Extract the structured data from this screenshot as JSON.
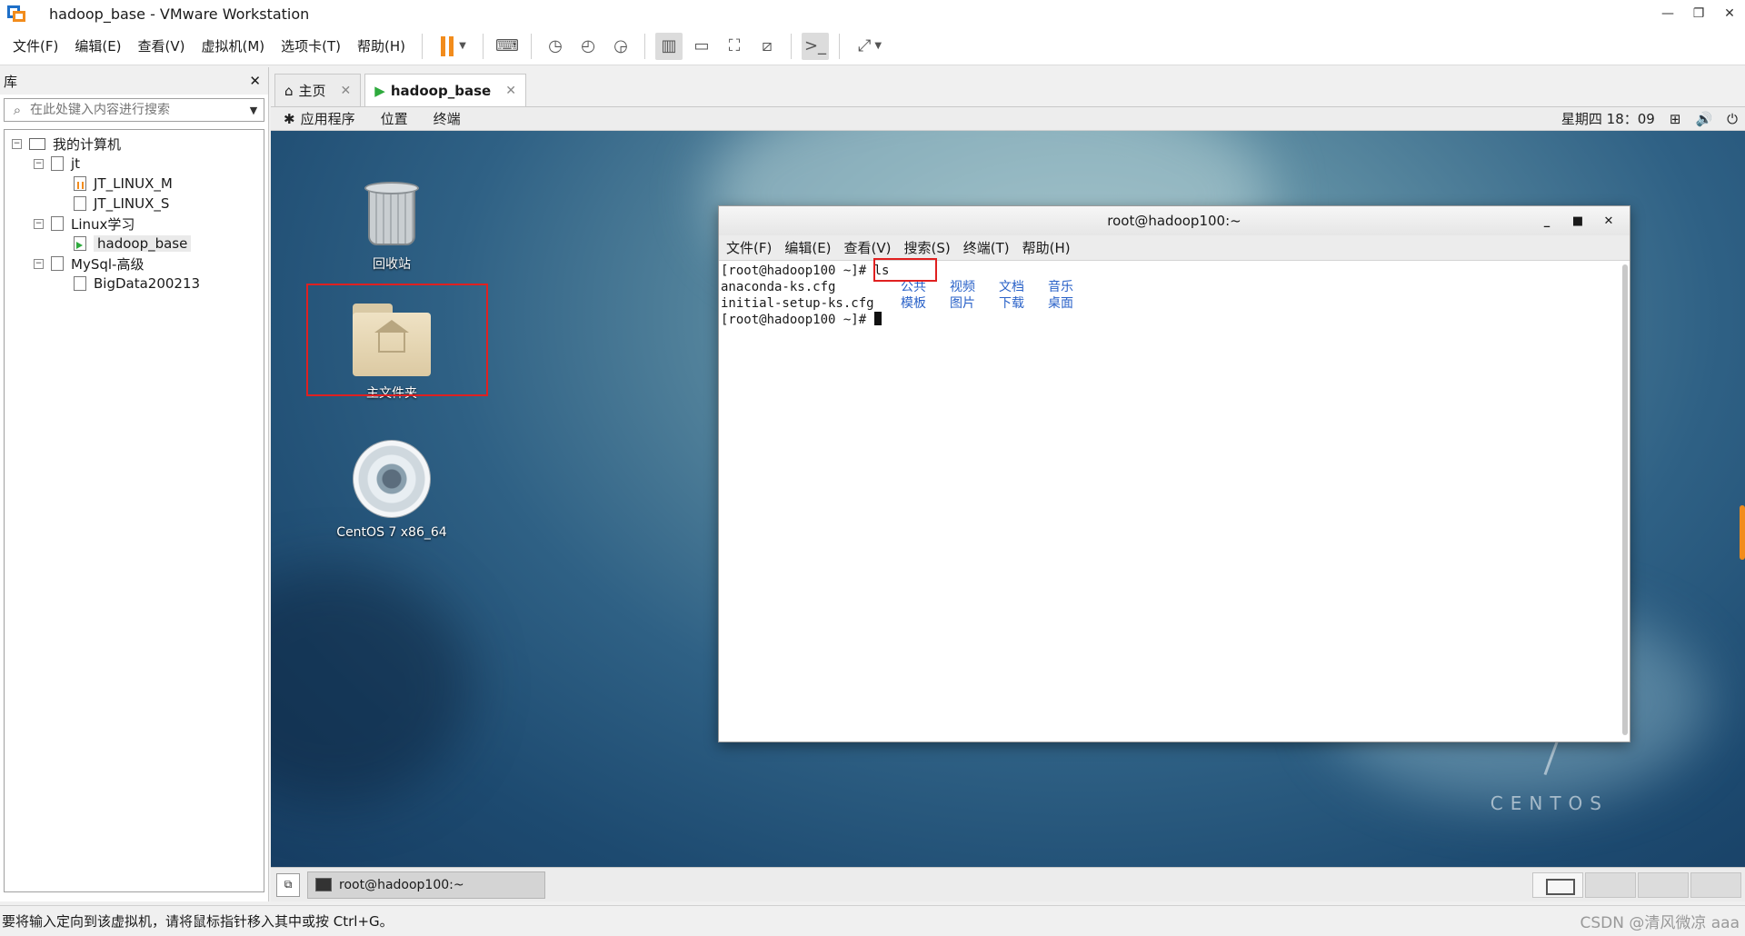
{
  "window": {
    "title": "hadoop_base - VMware Workstation"
  },
  "menu": [
    "文件(F)",
    "编辑(E)",
    "查看(V)",
    "虚拟机(M)",
    "选项卡(T)",
    "帮助(H)"
  ],
  "library": {
    "header": "库",
    "search_placeholder": "在此处键入内容进行搜索",
    "tree": {
      "root": "我的计算机",
      "items": [
        {
          "label": "jt",
          "children": [
            "JT_LINUX_M",
            "JT_LINUX_S"
          ]
        },
        {
          "label": "Linux学习",
          "children": [
            "hadoop_base"
          ]
        },
        {
          "label": "MySql-高级",
          "children": [
            "BigData200213"
          ]
        }
      ]
    }
  },
  "tabs": [
    {
      "label": "主页"
    },
    {
      "label": "hadoop_base"
    }
  ],
  "gnome_panel": {
    "applications": "应用程序",
    "places": "位置",
    "terminal": "终端",
    "clock": "星期四 18：09"
  },
  "desktop": {
    "icons": [
      "回收站",
      "主文件夹",
      "CentOS 7 x86_64"
    ],
    "brand": "CENTOS"
  },
  "terminal": {
    "title": "root@hadoop100:~",
    "menu": [
      "文件(F)",
      "编辑(E)",
      "查看(V)",
      "搜索(S)",
      "终端(T)",
      "帮助(H)"
    ],
    "prompt": "[root@hadoop100 ~]# ",
    "command": "ls",
    "files": [
      "anaconda-ks.cfg",
      "initial-setup-ks.cfg"
    ],
    "dirs_row1": [
      "公共",
      "视频",
      "文档",
      "音乐"
    ],
    "dirs_row2": [
      "模板",
      "图片",
      "下载",
      "桌面"
    ]
  },
  "vm_taskbar": {
    "task": "root@hadoop100:~"
  },
  "status": {
    "text": "要将输入定向到该虚拟机，请将鼠标指针移入其中或按 Ctrl+G。",
    "watermark": "CSDN @清风微凉 aaa"
  },
  "colors": {
    "accent": "#f28c1c",
    "highlight_box": "#e02020",
    "dir_blue": "#2a62c8"
  }
}
